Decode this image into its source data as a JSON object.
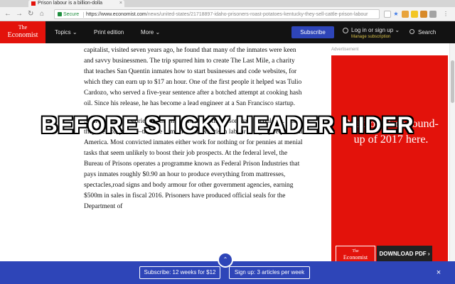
{
  "browser": {
    "tab_title": "Prison labour is a billion-dolla",
    "tab_close": "×",
    "secure_label": "Secure",
    "url_domain": "https://www.economist.com",
    "url_path": "/news/united-states/21718897-idaho-prisoners-roast-potatoes-kentucky-they-sell-cattle-prison-labour",
    "nav_back": "←",
    "nav_forward": "→",
    "nav_reload": "↻",
    "nav_home": "⌂"
  },
  "header": {
    "logo_line1": "The",
    "logo_line2": "Economist",
    "nav_topics": "Topics ⌄",
    "nav_print": "Print edition",
    "nav_more": "More ⌄",
    "subscribe": "Subscribe",
    "login": "Log in or sign up ⌄",
    "manage": "Manage subscription",
    "search": "Search"
  },
  "article": {
    "p1": "capitalist, visited seven years ago, he found that many of the inmates were keen and savvy businessmen. The trip spurred him to create The Last Mile, a charity that teaches San Quentin inmates how to start businesses and code websites, for which they can earn up to $17 an hour. One of the first people it helped was Tulio Cardozo, who served a five-year sentence after a botched attempt at cooking hash oil. Since his release, he has become a lead engineer at a San Francisco startup.",
    "p2": "Such redemptive stories are the model for what the prison system could be. But they are exceptions—the rule is much drearier. Prison labour is legally required in America. Most convicted inmates either work for nothing or for pennies at menial tasks that seem unlikely to boost their job prospects. At the federal level, the Bureau of Prisons operates a programme known as Federal Prison Industries that pays inmates roughly $0.90 an hour to produce everything from mattresses, spectacles,road signs and body armour for other government agencies, earning $500m in sales in fiscal 2016. Prisoners have produced official seals for the Department of"
  },
  "ad": {
    "label": "Advertisement",
    "text": "Read our free round-up of 2017 here.",
    "logo_line1": "The",
    "logo_line2": "Economist",
    "download": "DOWNLOAD PDF ›"
  },
  "overlay": {
    "caption": "BEFORE STICKY HEADER HIDER"
  },
  "bottom_bar": {
    "subscribe": "Subscribe: 12 weeks for $12",
    "signup": "Sign up: 3 articles per week",
    "close": "×",
    "toggle": "⌃"
  }
}
